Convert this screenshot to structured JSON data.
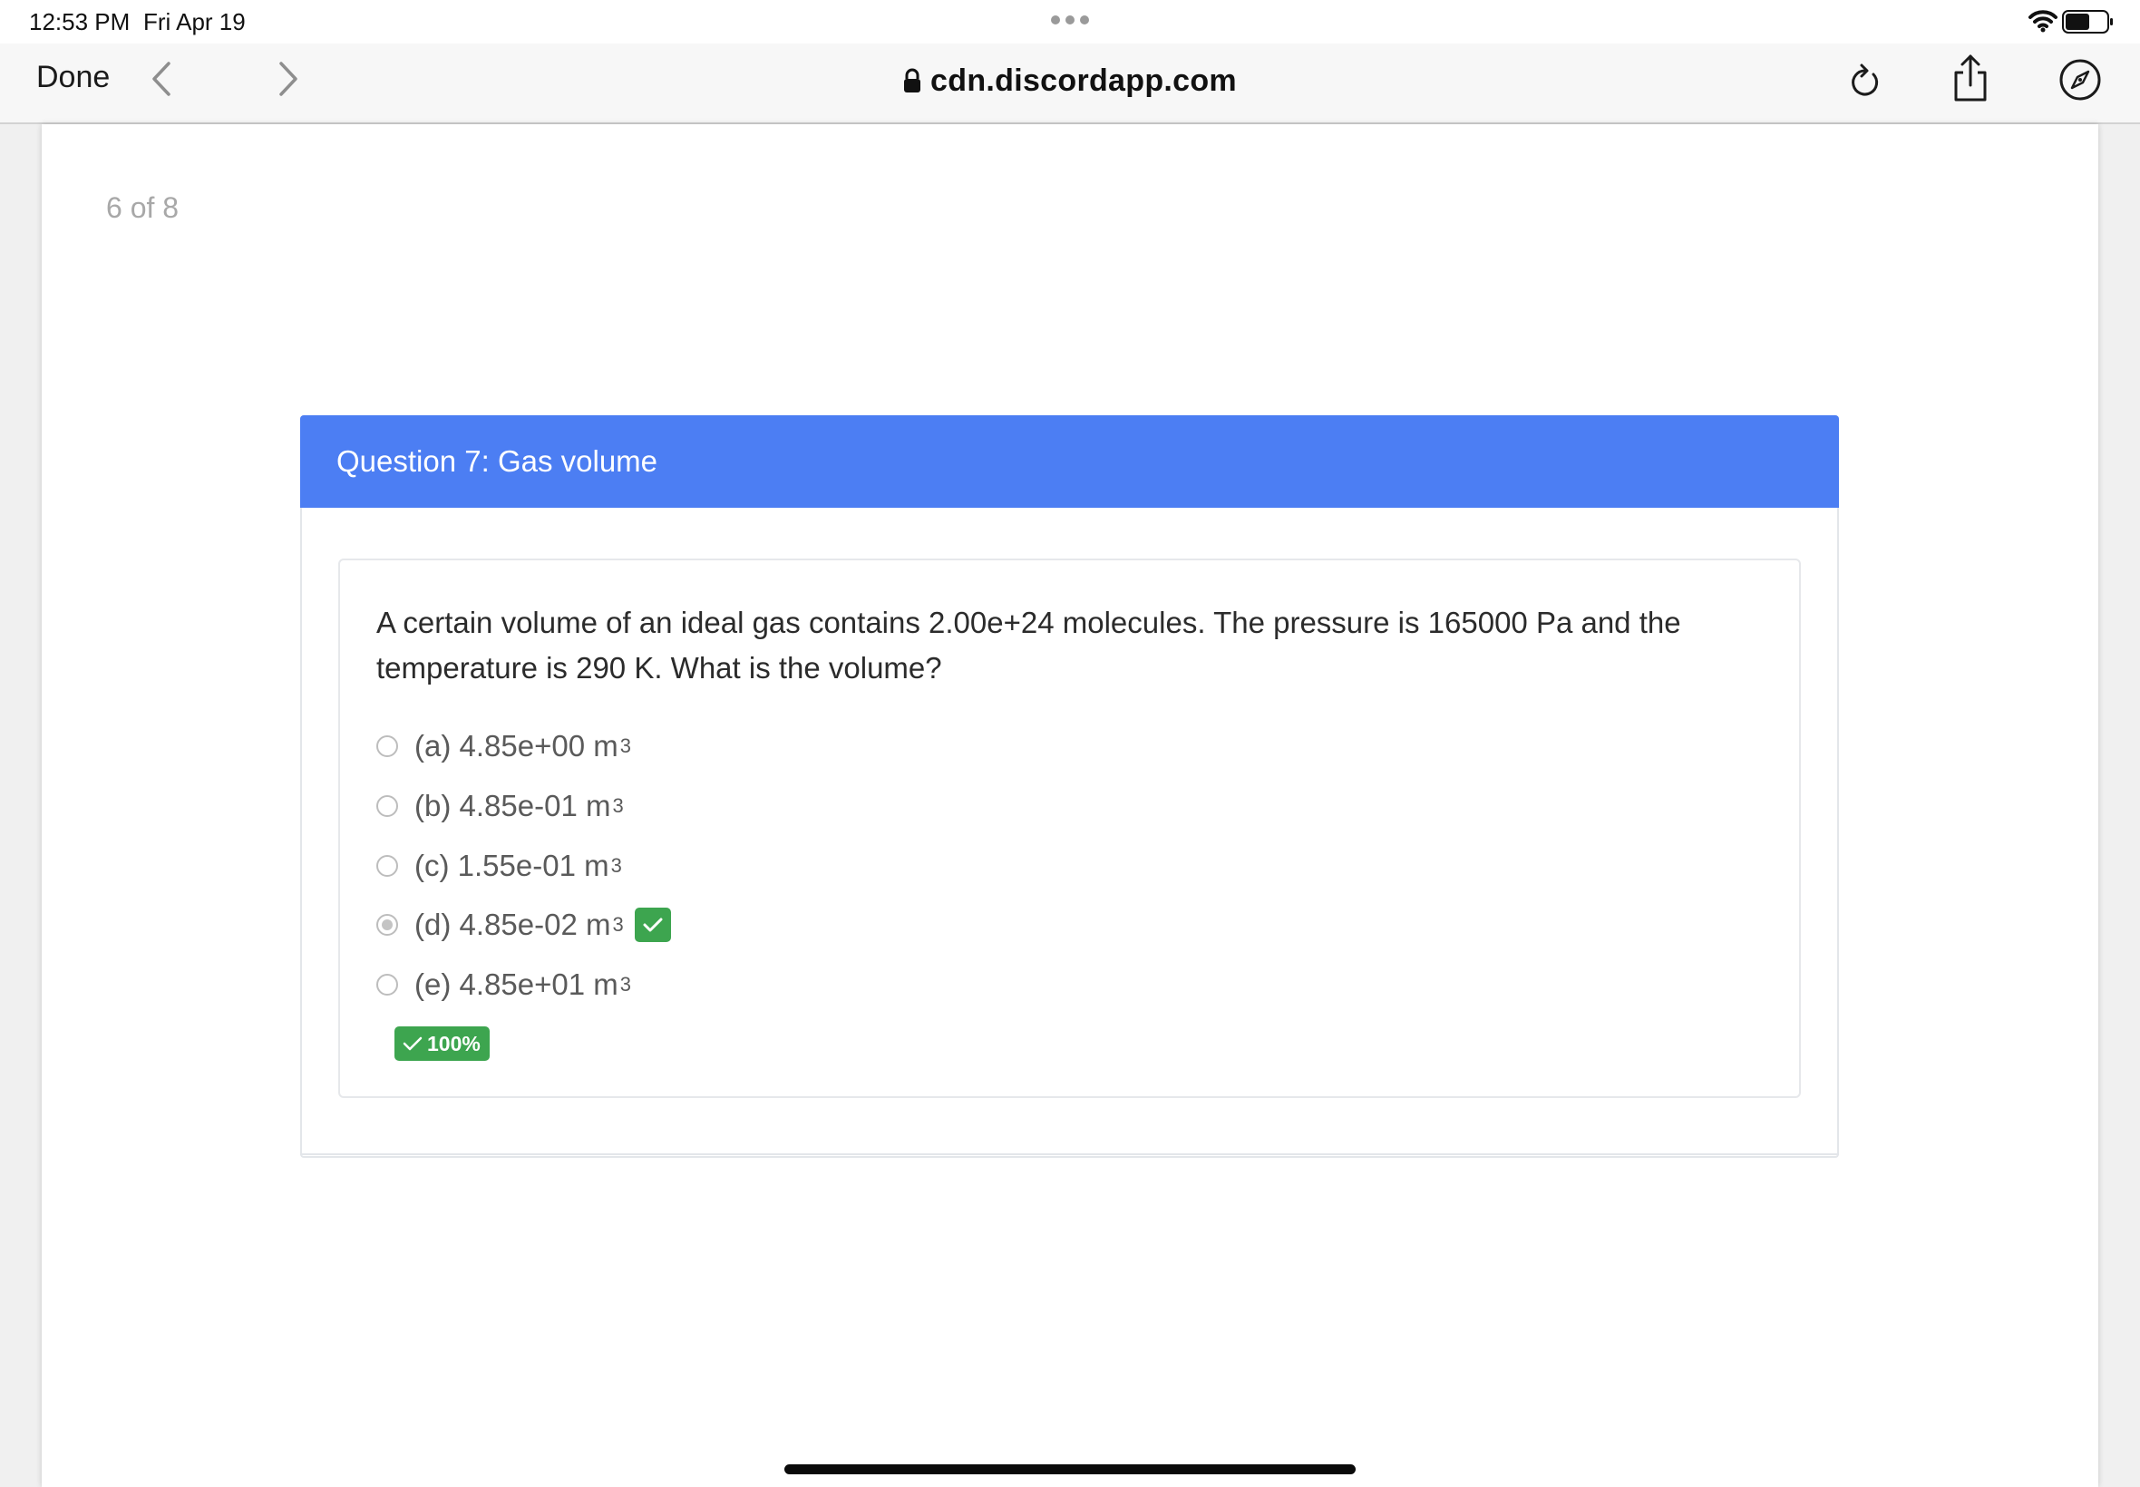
{
  "status_bar": {
    "time": "12:53 PM",
    "date": "Fri Apr 19"
  },
  "toolbar": {
    "done_label": "Done",
    "url": "cdn.discordapp.com"
  },
  "viewer": {
    "page_counter": "6 of 8"
  },
  "question": {
    "title": "Question 7: Gas volume",
    "text": "A certain volume of an ideal gas contains 2.00e+24 molecules. The pressure is 165000 Pa and the temperature is 290 K. What is the volume?",
    "options": [
      {
        "label": "(a)",
        "value": "4.85e+00 m",
        "sup": "3",
        "selected": false
      },
      {
        "label": "(b)",
        "value": "4.85e-01 m",
        "sup": "3",
        "selected": false
      },
      {
        "label": "(c)",
        "value": "1.55e-01 m",
        "sup": "3",
        "selected": false
      },
      {
        "label": "(d)",
        "value": "4.85e-02 m",
        "sup": "3",
        "selected": true,
        "correct": true
      },
      {
        "label": "(e)",
        "value": "4.85e+01 m",
        "sup": "3",
        "selected": false
      }
    ],
    "score": "100%"
  },
  "colors": {
    "header": "#4c7ef3",
    "correct": "#3da54f"
  }
}
